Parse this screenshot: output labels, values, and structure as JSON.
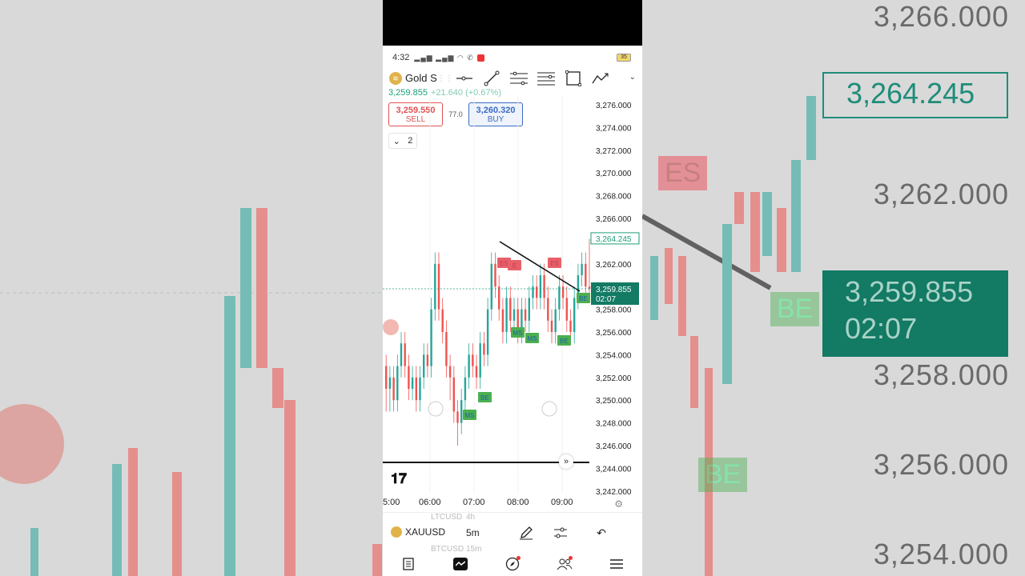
{
  "status_bar": {
    "time": "4:32",
    "battery": "35"
  },
  "symbol": {
    "name": "Gold Spot",
    "short": "Gold S",
    "price": "3,259.855",
    "change": "+21.640 (+0.67%)"
  },
  "trade": {
    "sell_price": "3,259.550",
    "sell_label": "SELL",
    "spread": "77.0",
    "buy_price": "3,260.320",
    "buy_label": "BUY"
  },
  "layers": {
    "count": "2"
  },
  "toolbar_icons": [
    "horizontal-ray-icon",
    "trend-line-icon",
    "parallel-channel-icon",
    "fib-retracement-icon",
    "rectangle-icon",
    "path-icon"
  ],
  "price_axis": {
    "ticks": [
      "3,276.000",
      "3,274.000",
      "3,272.000",
      "3,270.000",
      "3,268.000",
      "3,266.000",
      "3,262.000",
      "3,258.000",
      "3,256.000",
      "3,254.000",
      "3,252.000",
      "3,250.000",
      "3,248.000",
      "3,246.000",
      "3,244.000",
      "3,242.000"
    ],
    "high_label": "3,264.245",
    "current_label": "3,259.855",
    "countdown": "02:07"
  },
  "time_axis": [
    "5:00",
    "06:00",
    "07:00",
    "08:00",
    "09:00"
  ],
  "markers": [
    {
      "text": "ES",
      "color": "#e8606a"
    },
    {
      "text": "E",
      "color": "#e8606a"
    },
    {
      "text": "ES",
      "color": "#e8606a"
    },
    {
      "text": "MS",
      "color": "#4caf50"
    },
    {
      "text": "MS",
      "color": "#4caf50"
    },
    {
      "text": "BE",
      "color": "#4caf50"
    },
    {
      "text": "BE",
      "color": "#4caf50"
    },
    {
      "text": "MS",
      "color": "#4caf50"
    },
    {
      "text": "BE",
      "color": "#4caf50"
    }
  ],
  "bottom": {
    "symbol": "XAUUSD",
    "timeframe": "5m",
    "ghost_symbol_above": "LTCUSD",
    "ghost_tf_above": "4h",
    "ghost_symbol_below": "BTCUSD",
    "ghost_tf_below": "15m"
  },
  "nav": [
    "watchlist-icon",
    "chart-icon",
    "explore-icon",
    "community-icon",
    "menu-icon"
  ],
  "background": {
    "labels": [
      "3,266.000",
      "3,262.000",
      "3,258.000",
      "3,256.000",
      "3,254.000"
    ],
    "price_box": "3,264.245",
    "current_box": "3,259.855",
    "current_countdown": "02:07",
    "tags": [
      "ES",
      "BE",
      "BE"
    ]
  },
  "colors": {
    "up": "#26a69a",
    "down": "#ef5350",
    "accent": "#1b9e77"
  }
}
